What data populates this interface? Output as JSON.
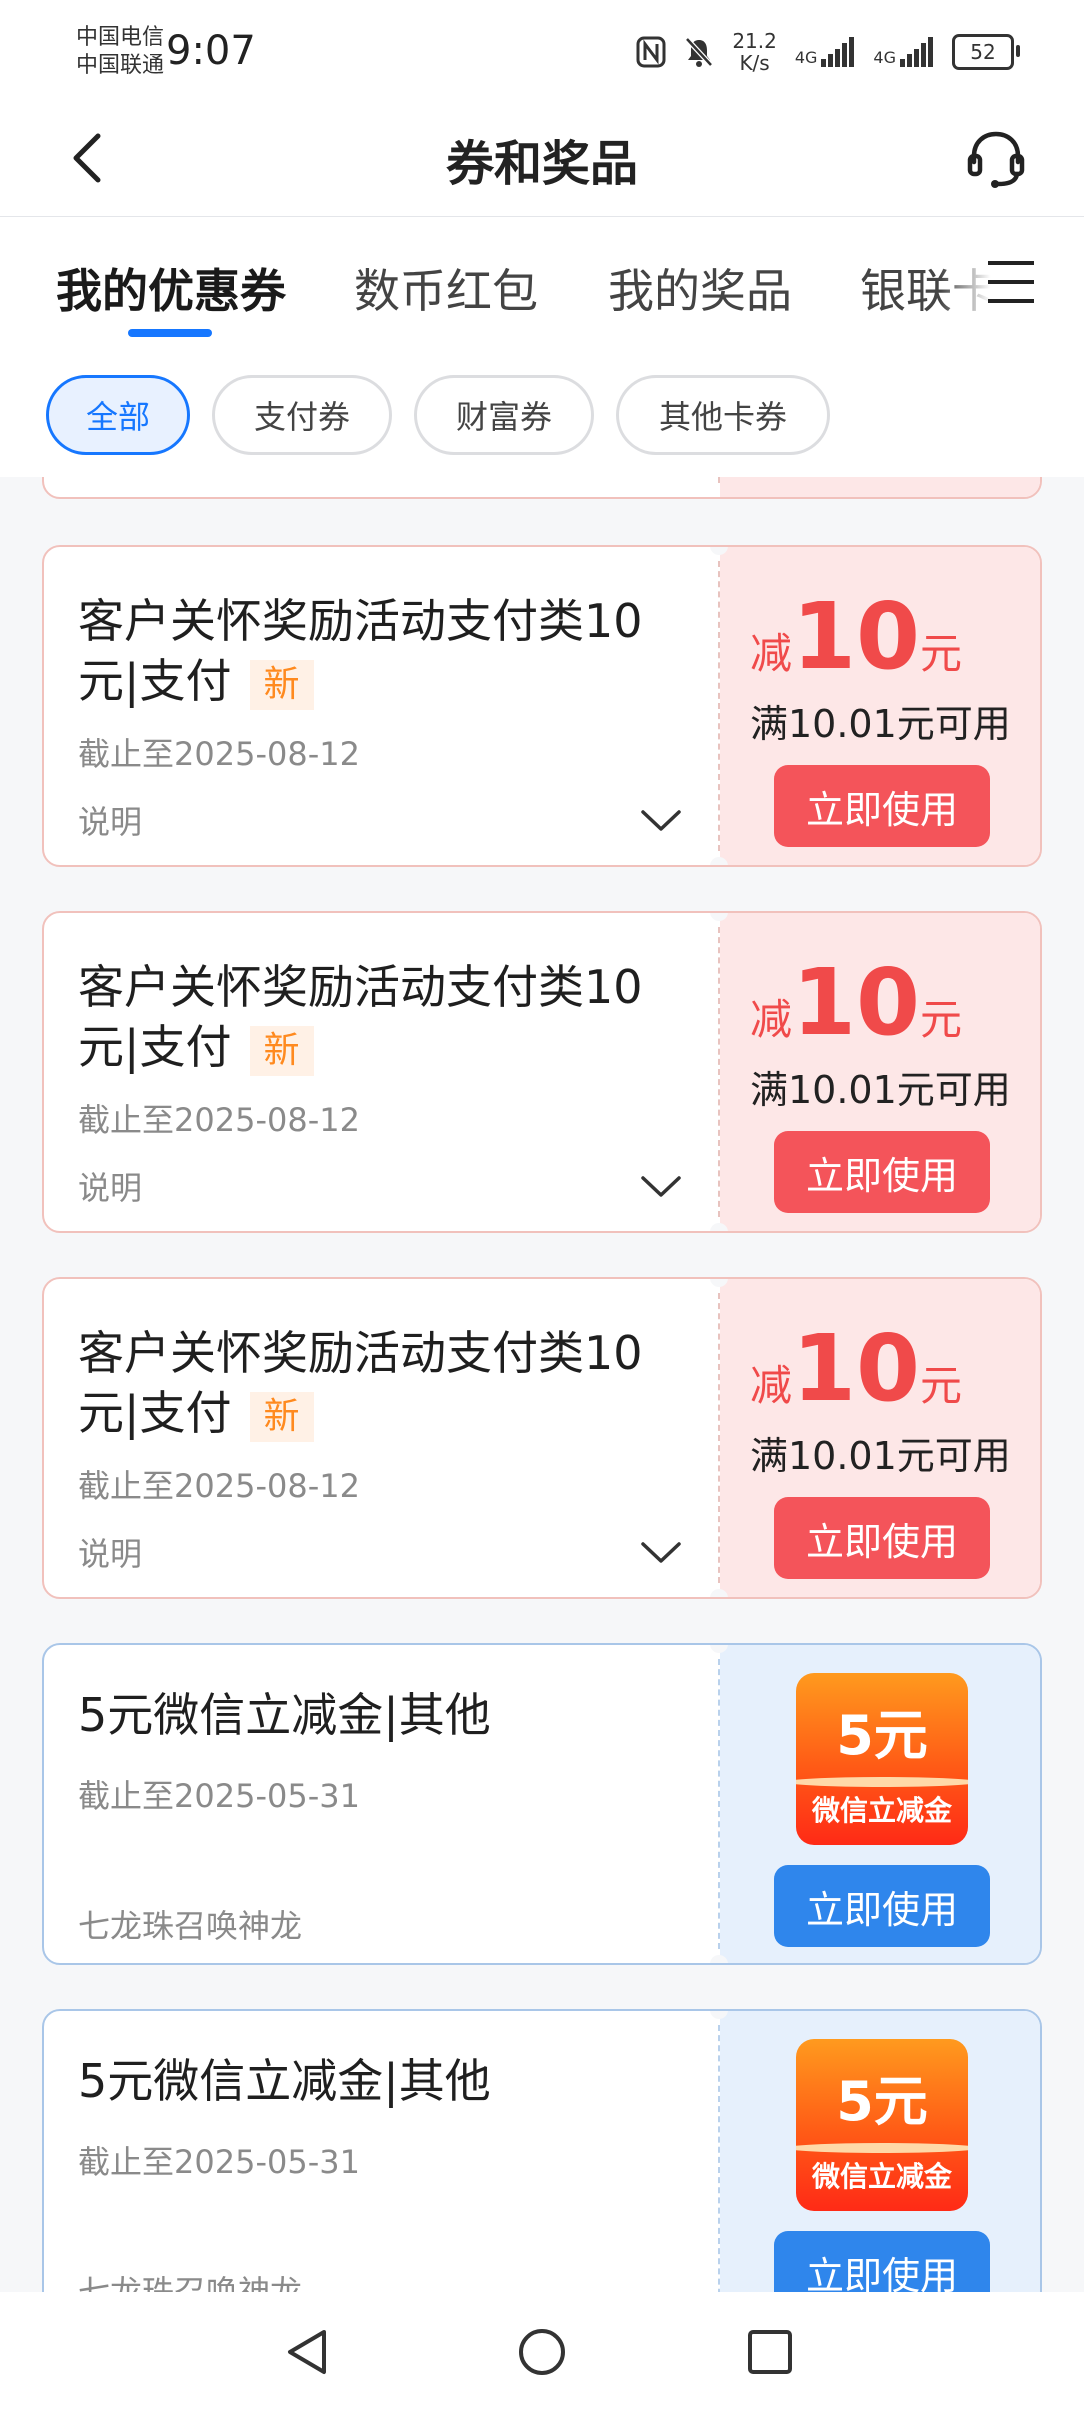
{
  "status_bar": {
    "carrier_1": "中国电信",
    "carrier_2": "中国联通",
    "time": "9:07",
    "net_speed_value": "21.2",
    "net_speed_unit": "K/s",
    "signal_1": "4G",
    "signal_2": "4G",
    "battery": "52"
  },
  "header": {
    "title": "券和奖品"
  },
  "tabs": [
    {
      "label": "我的优惠券"
    },
    {
      "label": "数币红包"
    },
    {
      "label": "我的奖品"
    },
    {
      "label": "银联卡"
    }
  ],
  "filters": [
    {
      "label": "全部"
    },
    {
      "label": "支付券"
    },
    {
      "label": "财富券"
    },
    {
      "label": "其他卡券"
    }
  ],
  "coupons": [
    {
      "title": "客户关怀奖励活动支付类10元|支付",
      "badge": "新",
      "expiry": "截止至2025-08-12",
      "note": "说明",
      "prefix": "减",
      "amount": "10",
      "unit": "元",
      "condition": "满10.01元可用",
      "button": "立即使用"
    },
    {
      "title": "客户关怀奖励活动支付类10元|支付",
      "badge": "新",
      "expiry": "截止至2025-08-12",
      "note": "说明",
      "prefix": "减",
      "amount": "10",
      "unit": "元",
      "condition": "满10.01元可用",
      "button": "立即使用"
    },
    {
      "title": "客户关怀奖励活动支付类10元|支付",
      "badge": "新",
      "expiry": "截止至2025-08-12",
      "note": "说明",
      "prefix": "减",
      "amount": "10",
      "unit": "元",
      "condition": "满10.01元可用",
      "button": "立即使用"
    }
  ],
  "wechat_coupons": [
    {
      "title": "5元微信立减金|其他",
      "expiry": "截止至2025-05-31",
      "note": "七龙珠召唤神龙",
      "tile_value": "5元",
      "tile_label": "微信立减金",
      "button": "立即使用"
    },
    {
      "title": "5元微信立减金|其他",
      "expiry": "截止至2025-05-31",
      "note": "七龙珠召唤神龙",
      "tile_value": "5元",
      "tile_label": "微信立减金",
      "button": "立即使用"
    }
  ],
  "colors": {
    "accent_blue": "#1677ff",
    "coupon_red": "#f04a4a",
    "button_red": "#f4545a",
    "button_blue": "#2f86ec",
    "badge_orange": "#ff8a1f"
  }
}
